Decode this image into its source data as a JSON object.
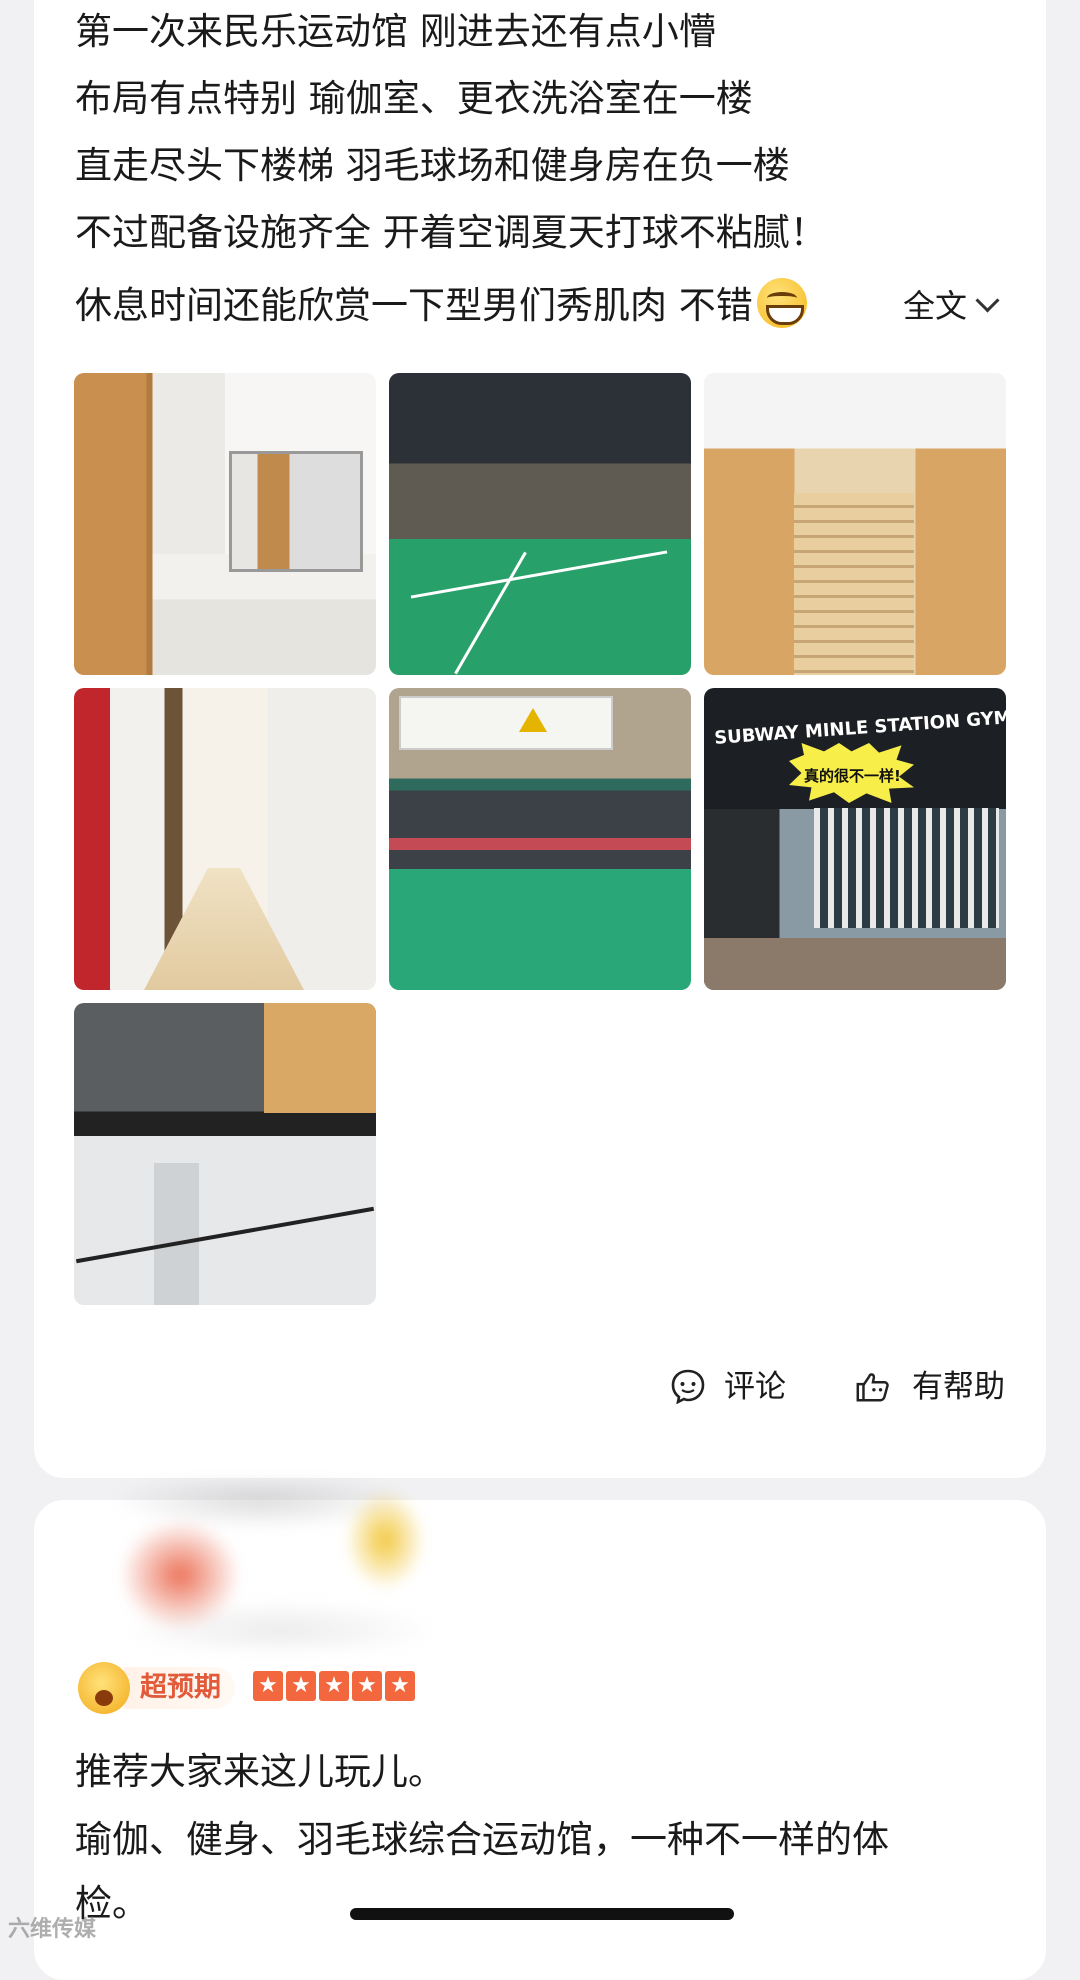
{
  "post": {
    "lines": [
      "第一次来民乐运动馆 刚进去还有点小懵",
      "布局有点特别 瑜伽室、更衣洗浴室在一楼",
      "直走尽头下楼梯 羽毛球场和健身房在负一楼",
      "不过配备设施齐全 开着空调夏天打球不粘腻！",
      "休息时间还能欣赏一下型男们秀肌肉 不错"
    ],
    "expand_label": "全文",
    "photos": [
      {
        "icon": "locker-room-photo"
      },
      {
        "icon": "badminton-court-photo"
      },
      {
        "icon": "staircase-photo"
      },
      {
        "icon": "corridor-photo"
      },
      {
        "icon": "badminton-hall-photo"
      },
      {
        "icon": "gym-entrance-photo",
        "signage": "SUBWAY MINLE STATION GYMNASIUM",
        "sticker": "真的很不一样!"
      },
      {
        "icon": "fitness-area-photo"
      }
    ],
    "actions": {
      "comment_label": "评论",
      "helpful_label": "有帮助"
    }
  },
  "review": {
    "badge_label": "超预期",
    "star_count": 5,
    "lines": [
      "推荐大家来这儿玩儿。",
      "瑜伽、健身、羽毛球综合运动馆，一种不一样的体",
      "检。"
    ]
  },
  "watermark": "六维传媒",
  "colors": {
    "accent_orange": "#f2673d",
    "badge_text": "#e25a3a",
    "background": "#f1f1f3",
    "card": "#ffffff"
  }
}
